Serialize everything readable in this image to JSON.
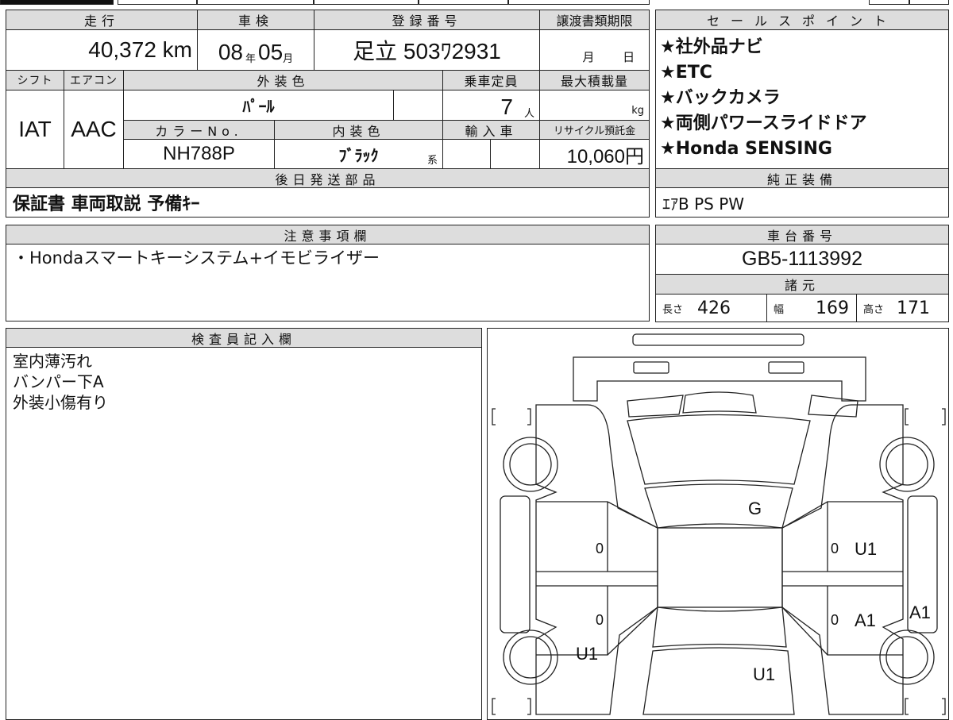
{
  "header_row": {
    "mileage_label": "走行",
    "inspection_label": "車検",
    "reg_label": "登録番号",
    "transfer_label": "譲渡書類期限"
  },
  "values": {
    "mileage": "40,372 km",
    "inspection_year": "08",
    "year_unit": "年",
    "inspection_month": "05",
    "month_unit": "月",
    "registration": "足立 503ﾜ2931",
    "transfer_month": "月",
    "transfer_day": "日"
  },
  "row2": {
    "shift_label": "シフト",
    "ac_label": "エアコン",
    "ext_color_label": "外装色",
    "capacity_label": "乗車定員",
    "max_load_label": "最大積載量"
  },
  "row2_values": {
    "shift": "IAT",
    "ac": "AAC",
    "ext_color": "ﾊﾟｰﾙ",
    "capacity": "7",
    "capacity_unit": "人",
    "load_unit": "kg"
  },
  "row3": {
    "color_no_label": "カラーNo.",
    "int_color_label": "内装色",
    "import_label": "輸入車",
    "recycle_label": "リサイクル預託金"
  },
  "row3_values": {
    "color_no": "NH788P",
    "int_color": "ﾌﾞﾗｯｸ",
    "int_suffix": "系",
    "recycle": "10,060円"
  },
  "later_parts": {
    "label": "後日発送部品",
    "value": "保証書 車両取説 予備ｷｰ"
  },
  "sales_points": {
    "label": "セールスポイント",
    "items": [
      "★社外品ナビ",
      "★ETC",
      "★バックカメラ",
      "★両側パワースライドドア",
      "★Honda SENSING"
    ]
  },
  "genuine": {
    "label": "純正装備",
    "value": "ｴｱB PS PW"
  },
  "notes": {
    "label": "注意事項欄",
    "value": "・Hondaスマートキーシステム+イモビライザー"
  },
  "chassis": {
    "label": "車台番号",
    "value": "GB5-1113992"
  },
  "specs": {
    "label": "諸元",
    "length_label": "長さ",
    "length": "426",
    "width_label": "幅",
    "width": "169",
    "height_label": "高さ",
    "height": "171"
  },
  "inspector": {
    "label": "検査員記入欄",
    "lines": [
      "室内薄汚れ",
      "バンパー下A",
      "外装小傷有り"
    ]
  },
  "diagram": {
    "marks": [
      "G",
      "0",
      "0",
      "U1",
      "0",
      "0",
      "A1",
      "A1",
      "U1",
      "U1"
    ]
  }
}
